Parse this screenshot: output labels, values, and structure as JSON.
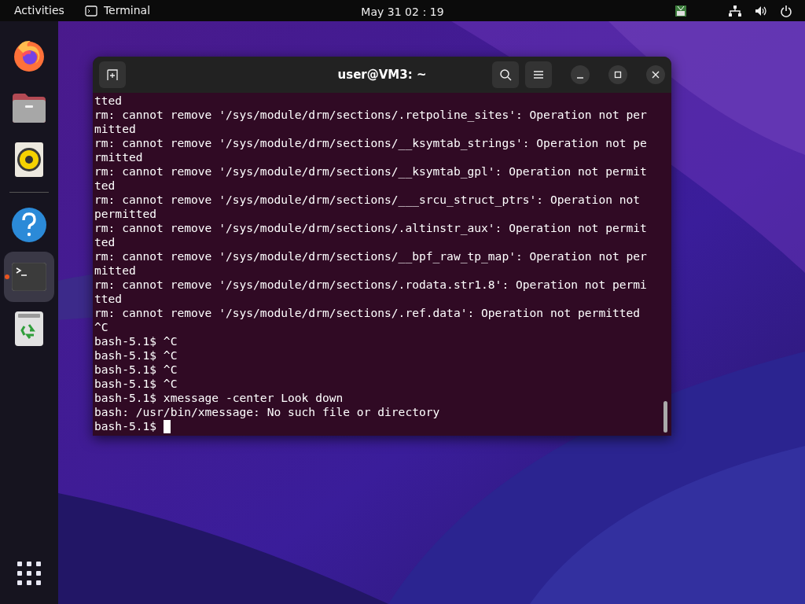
{
  "top_bar": {
    "activities": "Activities",
    "app_menu": "Terminal",
    "clock": "May 31 02：19"
  },
  "dock": {
    "groups": [
      {
        "items": [
          {
            "kind": "browser",
            "running": false,
            "selected": false
          },
          {
            "kind": "files",
            "running": false,
            "selected": false
          },
          {
            "kind": "music",
            "running": false,
            "selected": false
          }
        ]
      },
      {
        "items": [
          {
            "kind": "help",
            "running": false,
            "selected": false
          },
          {
            "kind": "terminal",
            "running": true,
            "selected": true
          },
          {
            "kind": "trash",
            "running": false,
            "selected": false
          }
        ]
      }
    ]
  },
  "window": {
    "title": "user@VM3: ~",
    "lines": [
      "tted",
      "rm: cannot remove '/sys/module/drm/sections/.retpoline_sites': Operation not per",
      "mitted",
      "rm: cannot remove '/sys/module/drm/sections/__ksymtab_strings': Operation not pe",
      "rmitted",
      "rm: cannot remove '/sys/module/drm/sections/__ksymtab_gpl': Operation not permit",
      "ted",
      "rm: cannot remove '/sys/module/drm/sections/___srcu_struct_ptrs': Operation not",
      "permitted",
      "rm: cannot remove '/sys/module/drm/sections/.altinstr_aux': Operation not permit",
      "ted",
      "rm: cannot remove '/sys/module/drm/sections/__bpf_raw_tp_map': Operation not per",
      "mitted",
      "rm: cannot remove '/sys/module/drm/sections/.rodata.str1.8': Operation not permi",
      "tted",
      "rm: cannot remove '/sys/module/drm/sections/.ref.data': Operation not permitted",
      "^C",
      "bash-5.1$ ^C",
      "bash-5.1$ ^C",
      "bash-5.1$ ^C",
      "bash-5.1$ ^C",
      "bash-5.1$ xmessage -center Look down",
      "bash: /usr/bin/xmessage: No such file or directory"
    ],
    "prompt": "bash-5.1$"
  }
}
